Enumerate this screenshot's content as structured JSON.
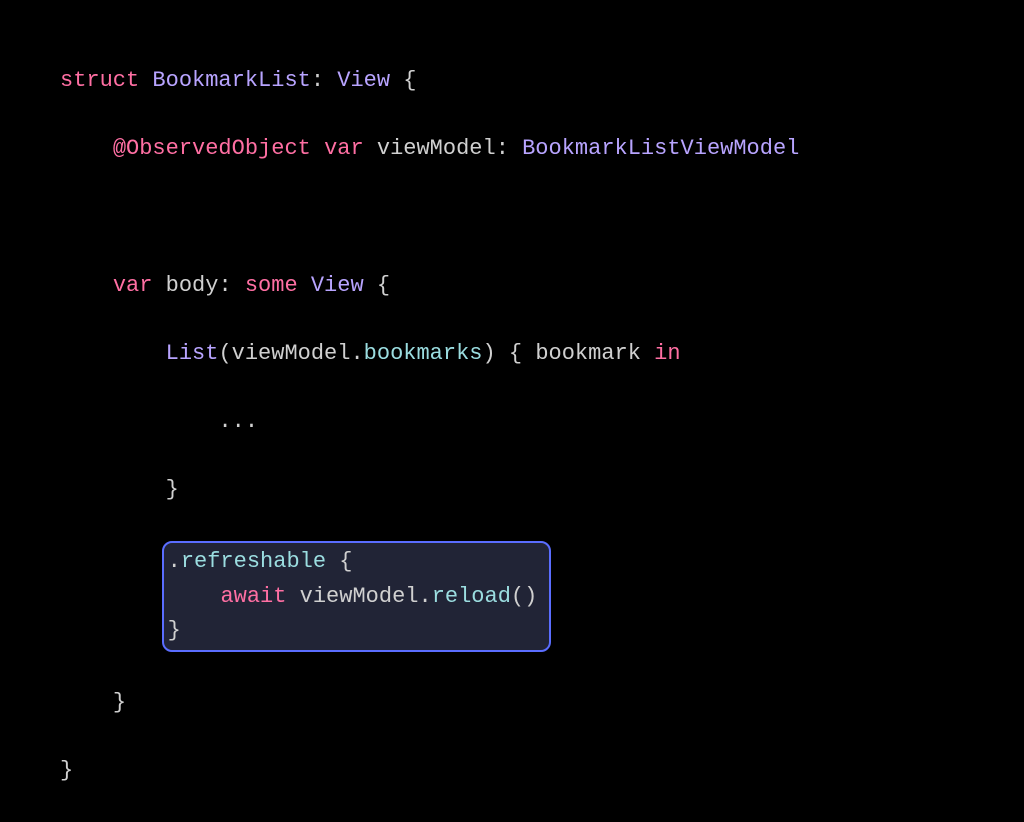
{
  "code": {
    "l1": {
      "struct": "struct",
      "name": "BookmarkList",
      "colon": ":",
      "proto": "View",
      "open": "{"
    },
    "l2": {
      "attr": "@ObservedObject",
      "var": "var",
      "ident": "viewModel",
      "colon": ":",
      "type": "BookmarkListViewModel"
    },
    "l3": {
      "var": "var",
      "ident": "body",
      "colon": ":",
      "some": "some",
      "type": "View",
      "open": "{"
    },
    "l4": {
      "fn": "List",
      "lp": "(",
      "obj": "viewModel",
      "dot": ".",
      "prop": "bookmarks",
      "rp": ")",
      "open": "{",
      "param": "bookmark",
      "in": "in"
    },
    "l5": {
      "dots": "..."
    },
    "l6": {
      "close": "}"
    },
    "l7": {
      "dot": ".",
      "method": "refreshable",
      "open": "{"
    },
    "l8": {
      "await": "await",
      "obj": "viewModel",
      "dot": ".",
      "method": "reload",
      "paren": "()"
    },
    "l9": {
      "close": "}"
    },
    "l10": {
      "close": "}"
    },
    "l11": {
      "close": "}"
    }
  },
  "highlight": {
    "color": "#5a6dff",
    "bg": "#212436"
  }
}
